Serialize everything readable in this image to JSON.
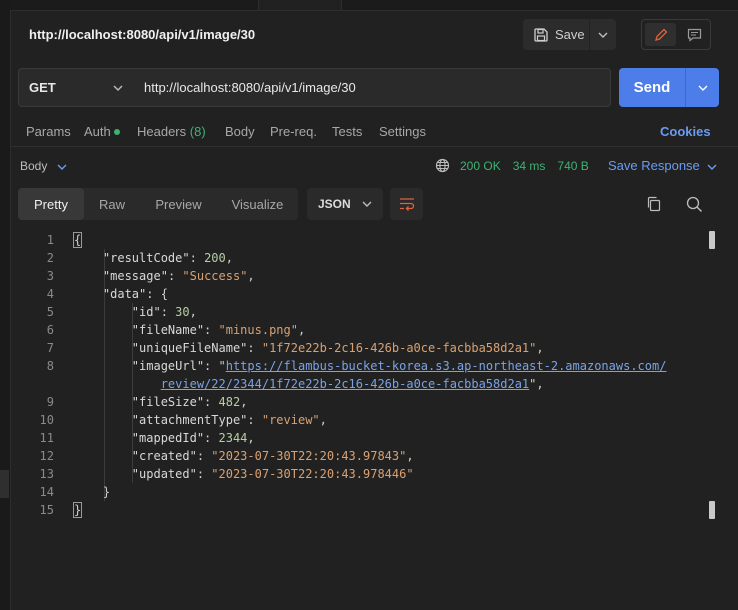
{
  "request": {
    "title": "http://localhost:8080/api/v1/image/30",
    "save_label": "Save",
    "method": "GET",
    "url": "http://localhost:8080/api/v1/image/30",
    "send_label": "Send"
  },
  "request_tabs": {
    "params": "Params",
    "auth": "Auth",
    "headers": "Headers",
    "headers_count": "(8)",
    "body": "Body",
    "prereq": "Pre-req.",
    "tests": "Tests",
    "settings": "Settings",
    "cookies": "Cookies"
  },
  "response": {
    "body_label": "Body",
    "status": "200 OK",
    "time": "34 ms",
    "size": "740 B",
    "save_response": "Save Response",
    "view_tabs": [
      "Pretty",
      "Raw",
      "Preview",
      "Visualize"
    ],
    "format": "JSON"
  },
  "code": {
    "line_numbers": [
      "1",
      "2",
      "3",
      "4",
      "5",
      "6",
      "7",
      "8",
      "",
      "9",
      "10",
      "11",
      "12",
      "13",
      "14",
      "15"
    ],
    "open_brace": "{",
    "close_brace": "}",
    "resultCode_key": "\"resultCode\"",
    "resultCode_val": "200",
    "message_key": "\"message\"",
    "message_val": "\"Success\"",
    "data_key": "\"data\"",
    "id_key": "\"id\"",
    "id_val": "30",
    "fileName_key": "\"fileName\"",
    "fileName_val": "\"minus.png\"",
    "uniqueFileName_key": "\"uniqueFileName\"",
    "uniqueFileName_val": "\"1f72e22b-2c16-426b-a0ce-facbba58d2a1\"",
    "imageUrl_key": "\"imageUrl\"",
    "imageUrl_part1": "https://flambus-bucket-korea.s3.ap-northeast-2.amazonaws.com/",
    "imageUrl_part2": "review/22/2344/1f72e22b-2c16-426b-a0ce-facbba58d2a1",
    "fileSize_key": "\"fileSize\"",
    "fileSize_val": "482",
    "attachmentType_key": "\"attachmentType\"",
    "attachmentType_val": "\"review\"",
    "mappedId_key": "\"mappedId\"",
    "mappedId_val": "2344",
    "created_key": "\"created\"",
    "created_val": "\"2023-07-30T22:20:43.97843\"",
    "updated_key": "\"updated\"",
    "updated_val": "\"2023-07-30T22:20:43.978446\""
  },
  "icons": {
    "save": "floppy-icon",
    "edit": "pencil-icon",
    "comment": "comment-icon",
    "globe": "globe-icon",
    "wrap": "wrap-lines-icon",
    "copy": "copy-icon",
    "search": "search-icon"
  },
  "colors": {
    "accent": "#4c7de8",
    "link": "#6b9bf2",
    "success": "#3cb371",
    "string": "#d9a172",
    "edit_icon": "#e0613f"
  }
}
